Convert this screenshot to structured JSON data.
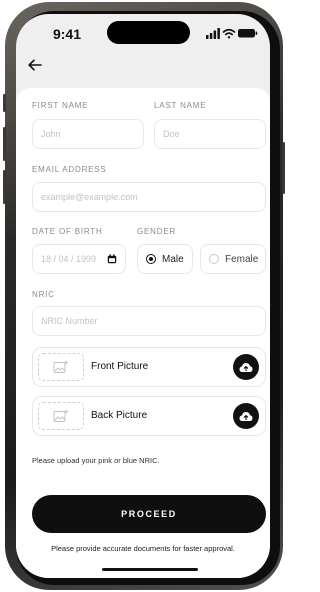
{
  "status_bar": {
    "time": "9:41",
    "icons": [
      "signal-icon",
      "wifi-icon",
      "battery-icon"
    ]
  },
  "nav": {
    "back_icon": "arrow-left-icon"
  },
  "form": {
    "first_name": {
      "label": "FIRST NAME",
      "placeholder": "John",
      "value": ""
    },
    "last_name": {
      "label": "LAST NAME",
      "placeholder": "Doe",
      "value": ""
    },
    "email": {
      "label": "EMAIL ADDRESS",
      "placeholder": "example@example.com",
      "value": ""
    },
    "dob": {
      "label": "DATE OF BIRTH",
      "placeholder": "18 / 04 / 1999",
      "icon": "calendar-icon"
    },
    "gender": {
      "label": "GENDER",
      "options": [
        {
          "label": "Male",
          "selected": true
        },
        {
          "label": "Female",
          "selected": false
        }
      ]
    },
    "nric": {
      "label": "NRIC",
      "placeholder": "NRIC Number",
      "value": ""
    },
    "uploads": [
      {
        "label": "Front Picture",
        "icon": "image-add-icon",
        "button_icon": "cloud-upload-icon"
      },
      {
        "label": "Back Picture",
        "icon": "image-add-icon",
        "button_icon": "cloud-upload-icon"
      }
    ],
    "upload_hint": "Please upload your pink or blue NRIC."
  },
  "actions": {
    "proceed_label": "PROCEED",
    "footnote": "Please provide accurate documents for faster approval."
  },
  "colors": {
    "primary": "#0f0f0f",
    "background": "#efefef",
    "card": "#ffffff",
    "border": "#e7e7e7"
  }
}
